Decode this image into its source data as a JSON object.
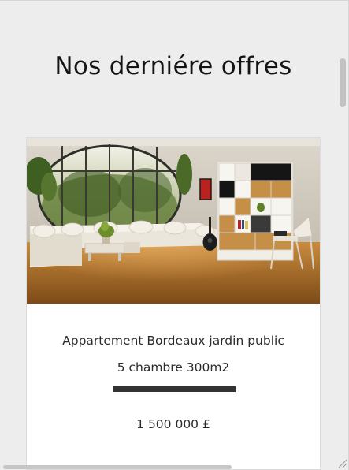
{
  "section": {
    "heading": "Nos derniére offres"
  },
  "listing": {
    "title": "Appartement Bordeaux jardin public",
    "details": "5 chambre 300m2",
    "price": "1 500 000 £",
    "image": {
      "subject": "living-room-photo",
      "colors": {
        "wall": "#cfc8bc",
        "floor": "#b8762e",
        "sofa": "#e8e2d8",
        "foliage": "#4f6b2c",
        "shelf_dark": "#1b1b1b",
        "shelf_wood": "#c8934a"
      }
    }
  },
  "scrollbars": {
    "vertical": "vertical-scrollbar",
    "horizontal": "horizontal-scrollbar"
  },
  "colors": {
    "page_background": "#ededed",
    "card_background": "#ffffff",
    "divider": "#333333",
    "text": "#2b2b2b"
  }
}
